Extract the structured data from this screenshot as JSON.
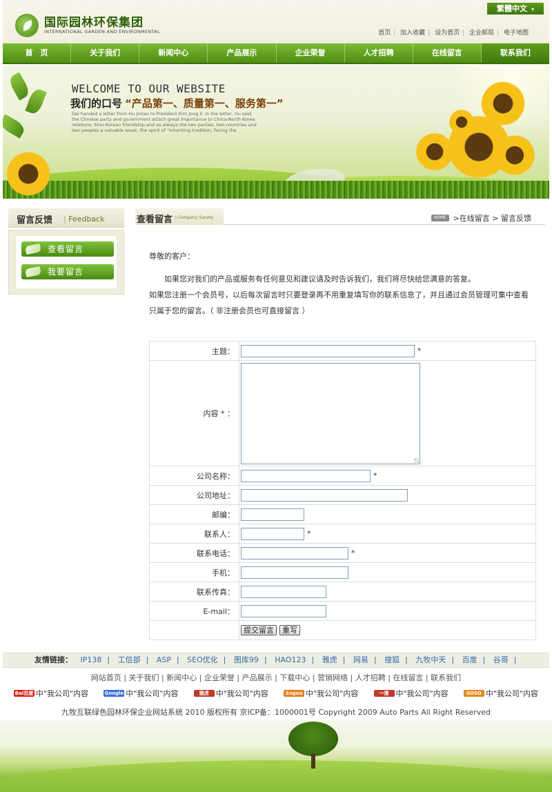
{
  "header": {
    "logo_cn": "国际园林环保集团",
    "logo_en": "INTERNATIONAL GARDEN AND ENVIRONMENTAL",
    "lang_button": "繁體中文",
    "top_links": [
      "首页",
      "加入收藏",
      "设为首页",
      "企业邮局",
      "电子地图"
    ]
  },
  "nav": [
    "首　页",
    "关于我们",
    "新闻中心",
    "产品展示",
    "企业荣誉",
    "人才招聘",
    "在线留言",
    "联系我们"
  ],
  "nav_active_index": 7,
  "banner": {
    "welcome": "WELCOME TO OUR WEBSITE",
    "slogan_prefix": "我们的口号",
    "slogan_highlight": "“产品第一、质量第一、服务第一”",
    "paragraph": "Dai handed a letter from Hu Jintao to President Kim Jong Il. In the letter, Hu said the Chinese party and government attach great importance to China-North Korea relations, Sino-Korean friendship and as always the two parties, two countries and two peoples a valuable asset, the spirit of \"inheriting tradition, facing the"
  },
  "sidebar": {
    "title": "留言反馈",
    "subtitle": "Feedback",
    "buttons": [
      "查看留言",
      "我要留言"
    ]
  },
  "content": {
    "title": "查看留言",
    "tag": "Company Survey",
    "home_icon": "HOME",
    "breadcrumb": ">在线留言 > 留言反馈",
    "intro_greeting": "尊敬的客户：",
    "intro_p1": "如果您对我们的产品或服务有任何意见和建议请及时告诉我们，我们将尽快给您满意的答复。",
    "intro_p2": "如果您注册一个会员号，以后每次留言时只要登录再不用重复填写你的联系信息了，并且通过会员管理可集中查看只属于您的留言。（ 非注册会员也可直接留言 ）"
  },
  "form": {
    "subject_label": "主题：",
    "content_label": "内容 * ：",
    "company_label": "公司名称：",
    "address_label": "公司地址：",
    "zip_label": "邮编：",
    "contact_label": "联系人：",
    "phone_label": "联系电话：",
    "mobile_label": "手机：",
    "fax_label": "联系传真：",
    "email_label": "E-mail：",
    "required_mark": "*",
    "submit": "提交留言",
    "reset": "重写"
  },
  "footer": {
    "friends_label": "友情链接：",
    "friends": [
      "IP138",
      "工信部",
      "ASP",
      "SEO优化",
      "图库99",
      "HAO123",
      "雅虎",
      "网易",
      "搜狐",
      "九牧中天",
      "百度",
      "谷哥"
    ],
    "links": "网站首页 | 关于我们 | 新闻中心 | 企业荣誉 | 产品展示 | 下载中心 | 营销网络 | 人才招聘 | 在线留言 | 联系我们",
    "engines": [
      {
        "logo": "Bai百度",
        "text": "中\"我公司\"内容",
        "color": "#d9261c"
      },
      {
        "logo": "Google",
        "text": "中\"我公司\"内容",
        "color": "#3a6fd8"
      },
      {
        "logo": "雅虎",
        "text": "中\"我公司\"内容",
        "color": "#c0392b"
      },
      {
        "logo": "Sogou",
        "text": "中\"我公司\"内容",
        "color": "#e67e22"
      },
      {
        "logo": "一搜",
        "text": "中\"我公司\"内容",
        "color": "#c0392b"
      },
      {
        "logo": "SOSO",
        "text": "中\"我公司\"内容",
        "color": "#e08a1e"
      }
    ],
    "copyright": "九牧互联绿色园林环保企业网站系统 2010 版权所有 京ICP备：1000001号 Copyright 2009 Auto Parts All Right Reserved"
  }
}
